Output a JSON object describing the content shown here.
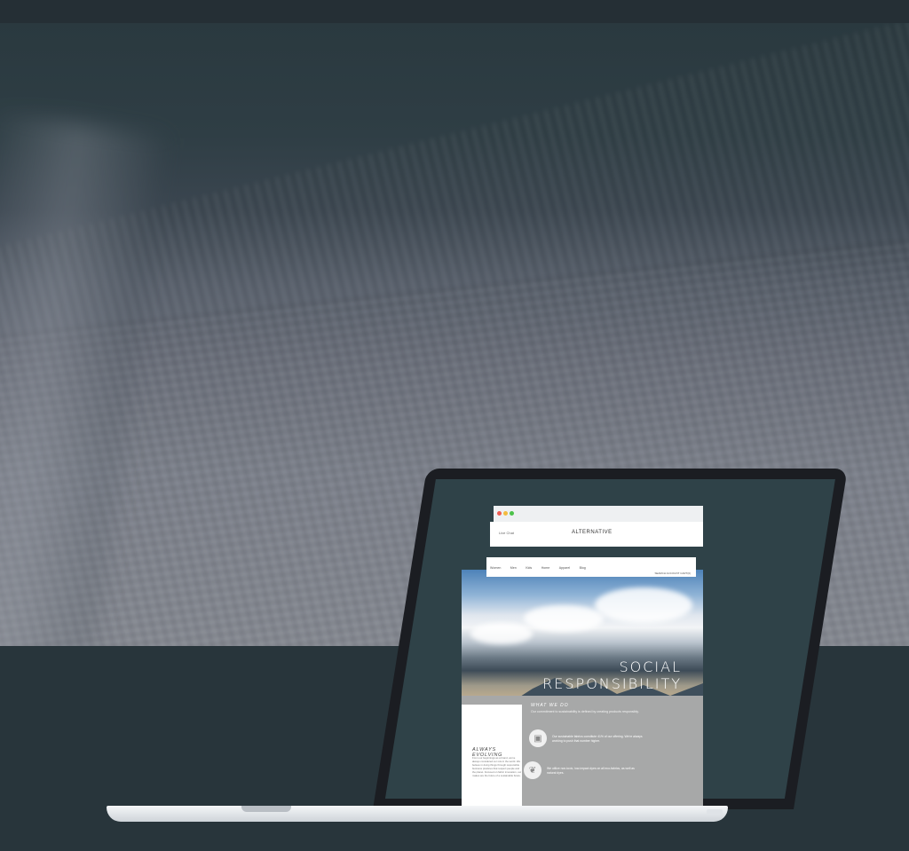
{
  "site": {
    "live_chat": "Live Chat",
    "brand": "ALTERNATIVE",
    "nav": [
      "Women",
      "Men",
      "Kids",
      "Home",
      "Apparel",
      "Blog"
    ],
    "nav_right": "SEARCH ACCOUNT CART(0)",
    "hero_title_line1": "SOCIAL",
    "hero_title_line2": "RESPONSIBILITY",
    "section_left_title": "ALWAYS EVOLVING",
    "section_left_text": "From our beginnings as a brand, we've always considered our role in the world. We believe in doing things through responsible business practices that respect people and the planet. Focused on fabric innovation, our makes are the future of a sustainable future.",
    "what_we_do_title": "WHAT WE DO",
    "what_we_do_sub": "Our commitment to sustainability is defined by creating products responsibly.",
    "feature1": "Our sustainable fabrics constitute 41% of our offering. We're always working to push that number higher.",
    "feature2": "We utilize non-toxic, low-impact dyes on all eco-fabrics, as well as natural dyes."
  },
  "icons": {
    "feature1_icon": "recycle-box-icon",
    "feature2_icon": "plant-icon"
  },
  "colors": {
    "background": "#28353b",
    "screen": "#2f4248",
    "accent_gray": "#a7a8a8"
  }
}
